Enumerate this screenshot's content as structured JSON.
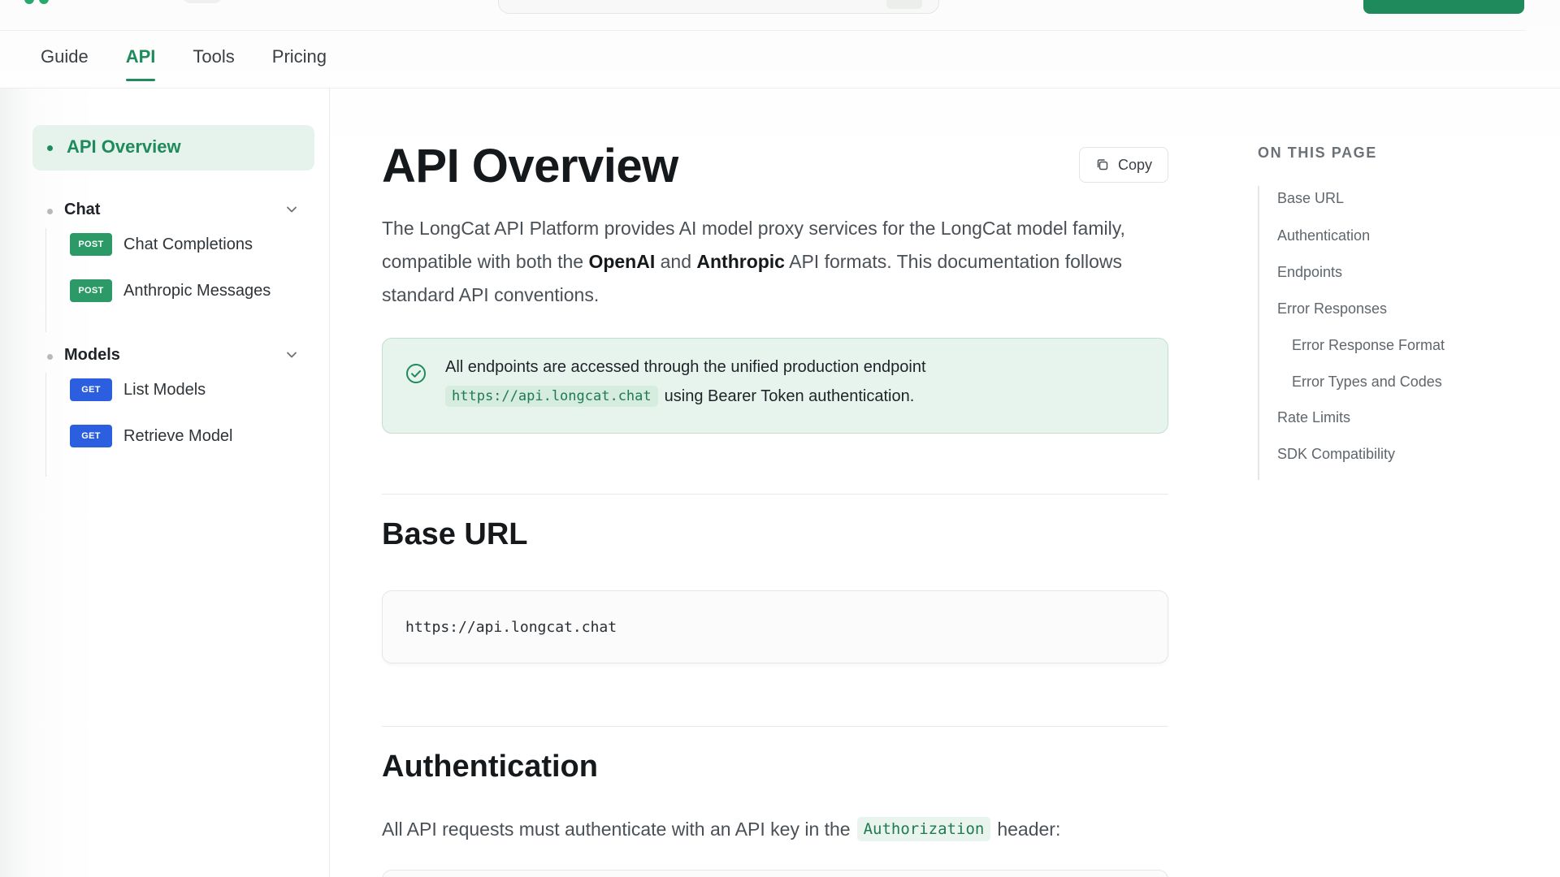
{
  "nav": {
    "tabs": [
      {
        "label": "Guide"
      },
      {
        "label": "API"
      },
      {
        "label": "Tools"
      },
      {
        "label": "Pricing"
      }
    ]
  },
  "sidebar": {
    "active": {
      "label": "API Overview"
    },
    "groups": [
      {
        "label": "Chat",
        "items": [
          {
            "method": "POST",
            "label": "Chat Completions"
          },
          {
            "method": "POST",
            "label": "Anthropic Messages"
          }
        ]
      },
      {
        "label": "Models",
        "items": [
          {
            "method": "GET",
            "label": "List Models"
          },
          {
            "method": "GET",
            "label": "Retrieve Model"
          }
        ]
      }
    ]
  },
  "main": {
    "title": "API Overview",
    "copy_label": "Copy",
    "intro": {
      "part1": "The LongCat API Platform provides AI model proxy services for the LongCat model family, compatible with both the ",
      "bold1": "OpenAI",
      "part2": " and ",
      "bold2": "Anthropic",
      "part3": " API formats. This documentation follows standard API conventions."
    },
    "callout": {
      "line1": "All endpoints are accessed through the unified production endpoint",
      "code": "https://api.longcat.chat",
      "line2": "using Bearer Token authentication."
    },
    "sections": [
      {
        "heading": "Base URL",
        "code": "https://api.longcat.chat"
      },
      {
        "heading": "Authentication",
        "text_before": "All API requests must authenticate with an API key in the",
        "code": "Authorization",
        "text_after": "header:"
      }
    ]
  },
  "toc": {
    "title": "ON THIS PAGE",
    "links": [
      {
        "label": "Base URL",
        "level": 1
      },
      {
        "label": "Authentication",
        "level": 1
      },
      {
        "label": "Endpoints",
        "level": 1
      },
      {
        "label": "Error Responses",
        "level": 1
      },
      {
        "label": "Error Response Format",
        "level": 2
      },
      {
        "label": "Error Types and Codes",
        "level": 2
      },
      {
        "label": "Rate Limits",
        "level": 1
      },
      {
        "label": "SDK Compatibility",
        "level": 1
      }
    ]
  },
  "colors": {
    "accent": "#1f8a5b",
    "post_badge": "#2b9a66",
    "get_badge": "#2c5fe0",
    "callout_bg": "#e7f4ed"
  },
  "icons": {
    "copy": "copy-icon",
    "check": "check-circle-icon",
    "chevron": "chevron-down-icon"
  }
}
